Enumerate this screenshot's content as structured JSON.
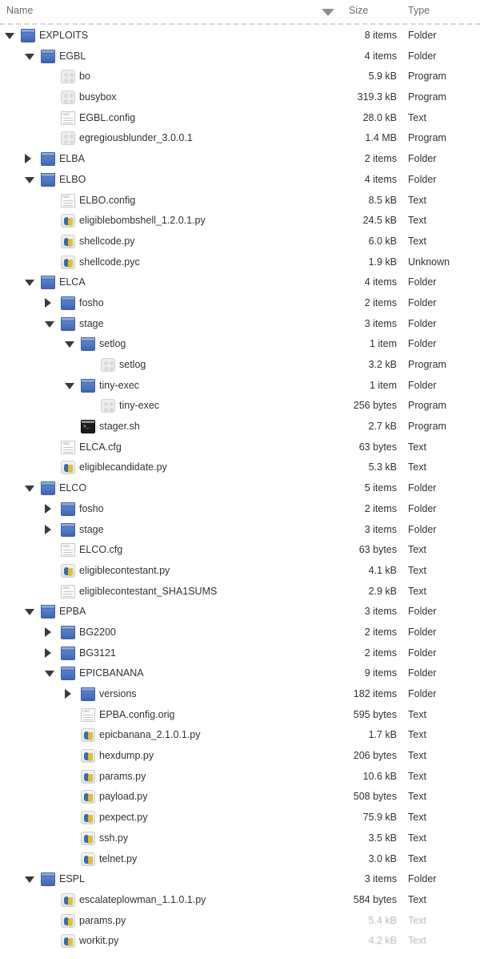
{
  "header": {
    "name_label": "Name",
    "size_label": "Size",
    "type_label": "Type",
    "sort_icon": "sort-descending-triangle-icon"
  },
  "rows": [
    {
      "depth": 0,
      "twisty": "open",
      "icon": "folder",
      "name": "EXPLOITS",
      "size": "8 items",
      "type": "Folder"
    },
    {
      "depth": 1,
      "twisty": "open",
      "icon": "folder",
      "name": "EGBL",
      "size": "4 items",
      "type": "Folder"
    },
    {
      "depth": 2,
      "twisty": "none",
      "icon": "program",
      "name": "bo",
      "size": "5.9 kB",
      "type": "Program"
    },
    {
      "depth": 2,
      "twisty": "none",
      "icon": "program",
      "name": "busybox",
      "size": "319.3 kB",
      "type": "Program"
    },
    {
      "depth": 2,
      "twisty": "none",
      "icon": "text",
      "name": "EGBL.config",
      "size": "28.0 kB",
      "type": "Text"
    },
    {
      "depth": 2,
      "twisty": "none",
      "icon": "program",
      "name": "egregiousblunder_3.0.0.1",
      "size": "1.4 MB",
      "type": "Program"
    },
    {
      "depth": 1,
      "twisty": "closed",
      "icon": "folder",
      "name": "ELBA",
      "size": "2 items",
      "type": "Folder"
    },
    {
      "depth": 1,
      "twisty": "open",
      "icon": "folder",
      "name": "ELBO",
      "size": "4 items",
      "type": "Folder"
    },
    {
      "depth": 2,
      "twisty": "none",
      "icon": "text",
      "name": "ELBO.config",
      "size": "8.5 kB",
      "type": "Text"
    },
    {
      "depth": 2,
      "twisty": "none",
      "icon": "python",
      "name": "eligiblebombshell_1.2.0.1.py",
      "size": "24.5 kB",
      "type": "Text"
    },
    {
      "depth": 2,
      "twisty": "none",
      "icon": "python",
      "name": "shellcode.py",
      "size": "6.0 kB",
      "type": "Text"
    },
    {
      "depth": 2,
      "twisty": "none",
      "icon": "python",
      "name": "shellcode.pyc",
      "size": "1.9 kB",
      "type": "Unknown"
    },
    {
      "depth": 1,
      "twisty": "open",
      "icon": "folder",
      "name": "ELCA",
      "size": "4 items",
      "type": "Folder"
    },
    {
      "depth": 2,
      "twisty": "closed",
      "icon": "folder",
      "name": "fosho",
      "size": "2 items",
      "type": "Folder"
    },
    {
      "depth": 2,
      "twisty": "open",
      "icon": "folder",
      "name": "stage",
      "size": "3 items",
      "type": "Folder"
    },
    {
      "depth": 3,
      "twisty": "open",
      "icon": "folder",
      "name": "setlog",
      "size": "1 item",
      "type": "Folder"
    },
    {
      "depth": 4,
      "twisty": "none",
      "icon": "program",
      "name": "setlog",
      "size": "3.2 kB",
      "type": "Program"
    },
    {
      "depth": 3,
      "twisty": "open",
      "icon": "folder",
      "name": "tiny-exec",
      "size": "1 item",
      "type": "Folder"
    },
    {
      "depth": 4,
      "twisty": "none",
      "icon": "program",
      "name": "tiny-exec",
      "size": "256 bytes",
      "type": "Program"
    },
    {
      "depth": 3,
      "twisty": "none",
      "icon": "shell",
      "name": "stager.sh",
      "size": "2.7 kB",
      "type": "Program"
    },
    {
      "depth": 2,
      "twisty": "none",
      "icon": "text",
      "name": "ELCA.cfg",
      "size": "63 bytes",
      "type": "Text"
    },
    {
      "depth": 2,
      "twisty": "none",
      "icon": "python",
      "name": "eligiblecandidate.py",
      "size": "5.3 kB",
      "type": "Text"
    },
    {
      "depth": 1,
      "twisty": "open",
      "icon": "folder",
      "name": "ELCO",
      "size": "5 items",
      "type": "Folder"
    },
    {
      "depth": 2,
      "twisty": "closed",
      "icon": "folder",
      "name": "fosho",
      "size": "2 items",
      "type": "Folder"
    },
    {
      "depth": 2,
      "twisty": "closed",
      "icon": "folder",
      "name": "stage",
      "size": "3 items",
      "type": "Folder"
    },
    {
      "depth": 2,
      "twisty": "none",
      "icon": "text",
      "name": "ELCO.cfg",
      "size": "63 bytes",
      "type": "Text"
    },
    {
      "depth": 2,
      "twisty": "none",
      "icon": "python",
      "name": "eligiblecontestant.py",
      "size": "4.1 kB",
      "type": "Text"
    },
    {
      "depth": 2,
      "twisty": "none",
      "icon": "text",
      "name": "eligiblecontestant_SHA1SUMS",
      "size": "2.9 kB",
      "type": "Text"
    },
    {
      "depth": 1,
      "twisty": "open",
      "icon": "folder",
      "name": "EPBA",
      "size": "3 items",
      "type": "Folder"
    },
    {
      "depth": 2,
      "twisty": "closed",
      "icon": "folder",
      "name": "BG2200",
      "size": "2 items",
      "type": "Folder"
    },
    {
      "depth": 2,
      "twisty": "closed",
      "icon": "folder",
      "name": "BG3121",
      "size": "2 items",
      "type": "Folder"
    },
    {
      "depth": 2,
      "twisty": "open",
      "icon": "folder",
      "name": "EPICBANANA",
      "size": "9 items",
      "type": "Folder"
    },
    {
      "depth": 3,
      "twisty": "closed",
      "icon": "folder",
      "name": "versions",
      "size": "182 items",
      "type": "Folder"
    },
    {
      "depth": 3,
      "twisty": "none",
      "icon": "text",
      "name": "EPBA.config.orig",
      "size": "595 bytes",
      "type": "Text"
    },
    {
      "depth": 3,
      "twisty": "none",
      "icon": "python",
      "name": "epicbanana_2.1.0.1.py",
      "size": "1.7 kB",
      "type": "Text"
    },
    {
      "depth": 3,
      "twisty": "none",
      "icon": "python",
      "name": "hexdump.py",
      "size": "206 bytes",
      "type": "Text"
    },
    {
      "depth": 3,
      "twisty": "none",
      "icon": "python",
      "name": "params.py",
      "size": "10.6 kB",
      "type": "Text"
    },
    {
      "depth": 3,
      "twisty": "none",
      "icon": "python",
      "name": "payload.py",
      "size": "508 bytes",
      "type": "Text"
    },
    {
      "depth": 3,
      "twisty": "none",
      "icon": "python",
      "name": "pexpect.py",
      "size": "75.9 kB",
      "type": "Text"
    },
    {
      "depth": 3,
      "twisty": "none",
      "icon": "python",
      "name": "ssh.py",
      "size": "3.5 kB",
      "type": "Text"
    },
    {
      "depth": 3,
      "twisty": "none",
      "icon": "python",
      "name": "telnet.py",
      "size": "3.0 kB",
      "type": "Text"
    },
    {
      "depth": 1,
      "twisty": "open",
      "icon": "folder",
      "name": "ESPL",
      "size": "3 items",
      "type": "Folder"
    },
    {
      "depth": 2,
      "twisty": "none",
      "icon": "python",
      "name": "escalateplowman_1.1.0.1.py",
      "size": "584 bytes",
      "type": "Text"
    },
    {
      "depth": 2,
      "twisty": "none",
      "icon": "python",
      "name": "params.py",
      "size": "5.4 kB",
      "type": "Text",
      "faded": true
    },
    {
      "depth": 2,
      "twisty": "none",
      "icon": "python",
      "name": "workit.py",
      "size": "4.2 kB",
      "type": "Text",
      "faded": true
    }
  ]
}
